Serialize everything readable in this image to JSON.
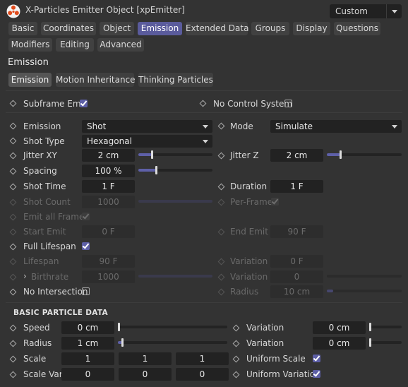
{
  "header": {
    "title": "X-Particles Emitter Object [xpEmitter]",
    "preset": "Custom"
  },
  "tabs": [
    "Basic",
    "Coordinates",
    "Object",
    "Emission",
    "Extended Data",
    "Groups",
    "Display",
    "Questions",
    "Modifiers",
    "Editing",
    "Advanced"
  ],
  "active_tab": "Emission",
  "section_title": "Emission",
  "subtabs": [
    "Emission",
    "Motion Inheritance",
    "Thinking Particles"
  ],
  "fields": {
    "subframe_emit": "Subframe Emit",
    "no_control_system": "No Control System",
    "emission_label": "Emission",
    "emission_value": "Shot",
    "mode_label": "Mode",
    "mode_value": "Simulate",
    "shot_type_label": "Shot Type",
    "shot_type_value": "Hexagonal",
    "jitter_xy_label": "Jitter XY",
    "jitter_xy_value": "2 cm",
    "jitter_z_label": "Jitter Z",
    "jitter_z_value": "2 cm",
    "spacing_label": "Spacing",
    "spacing_value": "100 %",
    "shot_time_label": "Shot Time",
    "shot_time_value": "1 F",
    "duration_label": "Duration",
    "duration_value": "1 F",
    "shot_count_label": "Shot Count",
    "shot_count_value": "1000",
    "per_frame_label": "Per-Frame",
    "emit_all_frames_label": "Emit all Frames",
    "start_emit_label": "Start Emit",
    "start_emit_value": "0 F",
    "end_emit_label": "End Emit",
    "end_emit_value": "90 F",
    "full_lifespan_label": "Full Lifespan",
    "lifespan_label": "Lifespan",
    "lifespan_value": "90 F",
    "lifespan_variation_label": "Variation",
    "lifespan_variation_value": "0 F",
    "birthrate_label": "Birthrate",
    "birthrate_value": "1000",
    "birthrate_variation_label": "Variation",
    "birthrate_variation_value": "0",
    "no_intersection_label": "No Intersection",
    "radius_dim_label": "Radius",
    "radius_dim_value": "10 cm"
  },
  "basic_data": {
    "header": "BASIC PARTICLE DATA",
    "speed_label": "Speed",
    "speed_value": "0 cm",
    "speed_variation_label": "Variation",
    "speed_variation_value": "0 cm",
    "radius_label": "Radius",
    "radius_value": "1 cm",
    "radius_variation_label": "Variation",
    "radius_variation_value": "0 cm",
    "scale_label": "Scale",
    "scale_x": "1",
    "scale_y": "1",
    "scale_z": "1",
    "uniform_scale_label": "Uniform Scale",
    "scale_var_label": "Scale Var.",
    "scale_var_x": "0",
    "scale_var_y": "0",
    "scale_var_z": "0",
    "uniform_variation_label": "Uniform Variation"
  },
  "colors": {
    "accent": "#5a5b9c",
    "background": "#333333",
    "field": "#222222"
  }
}
